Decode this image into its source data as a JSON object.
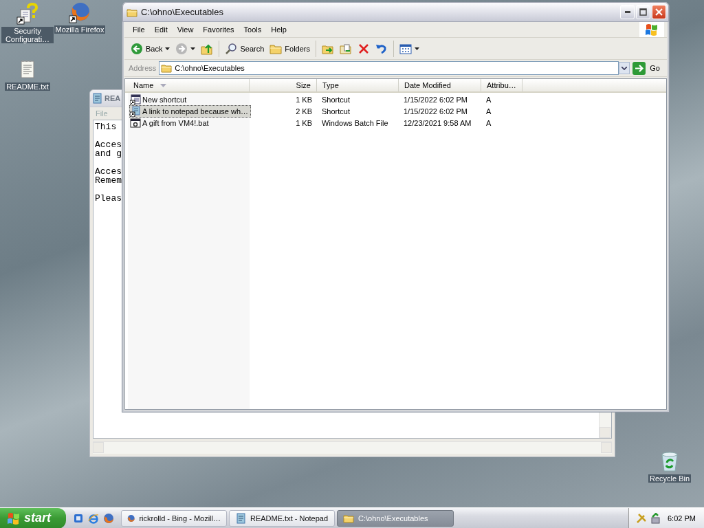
{
  "desktop_icons": [
    {
      "label": "Security Configurati…",
      "kind": "security"
    },
    {
      "label": "Mozilla Firefox",
      "kind": "firefox"
    },
    {
      "label": "README.txt",
      "kind": "text"
    },
    {
      "label": "Recycle Bin",
      "kind": "recycle"
    }
  ],
  "notepad": {
    "title": "REA",
    "menu": [
      "File"
    ],
    "paragraphs": [
      [
        "This"
      ],
      [
        "Acces",
        "and g"
      ],
      [
        "Acces",
        "Remem"
      ],
      [
        "Pleas"
      ]
    ]
  },
  "explorer": {
    "title": "C:\\ohno\\Executables",
    "menu": [
      "File",
      "Edit",
      "View",
      "Favorites",
      "Tools",
      "Help"
    ],
    "toolbar": [
      {
        "kind": "back",
        "label": "Back"
      },
      {
        "kind": "forward"
      },
      {
        "kind": "up"
      },
      {
        "kind": "search",
        "label": "Search"
      },
      {
        "kind": "folders",
        "label": "Folders"
      },
      {
        "kind": "move"
      },
      {
        "kind": "copy"
      },
      {
        "kind": "delete"
      },
      {
        "kind": "undo"
      },
      {
        "kind": "views"
      }
    ],
    "address": {
      "label": "Address",
      "value": "C:\\ohno\\Executables",
      "go": "Go"
    },
    "columns": [
      "Name",
      "Size",
      "Type",
      "Date Modified",
      "Attribu…"
    ],
    "files": [
      {
        "kind": "shortcut",
        "name": "New shortcut",
        "size": "1 KB",
        "type": "Shortcut",
        "date": "1/15/2022 6:02 PM",
        "attributes": "A",
        "selected": false
      },
      {
        "kind": "notepad_shortcut",
        "name": "A link to notepad because wh…",
        "size": "2 KB",
        "type": "Shortcut",
        "date": "1/15/2022 6:02 PM",
        "attributes": "A",
        "selected": true
      },
      {
        "kind": "batch",
        "name": "A gift from VM4!.bat",
        "size": "1 KB",
        "type": "Windows Batch File",
        "date": "12/23/2021 9:58 AM",
        "attributes": "A",
        "selected": false
      }
    ]
  },
  "taskbar": {
    "start": "start",
    "quick_launch": [
      {
        "kind": "desktop"
      },
      {
        "kind": "ie"
      },
      {
        "kind": "firefox"
      }
    ],
    "tasks": [
      {
        "kind": "firefox",
        "label": "rickrolld - Bing - Mozill…",
        "selected": false
      },
      {
        "kind": "notepad",
        "label": "README.txt - Notepad",
        "selected": false
      },
      {
        "kind": "folder",
        "label": "C:\\ohno\\Executables",
        "selected": true
      }
    ],
    "clock": "6:02 PM"
  }
}
